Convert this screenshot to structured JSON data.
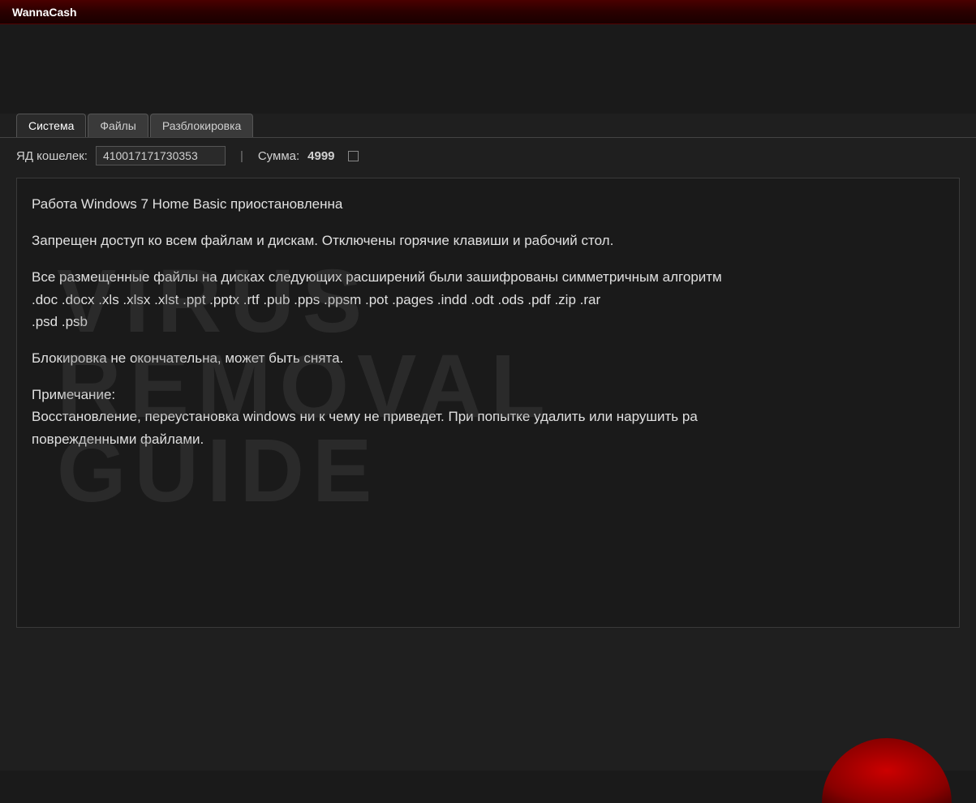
{
  "window": {
    "title": "WannaCash"
  },
  "tabs": [
    {
      "label": "Система",
      "active": true
    },
    {
      "label": "Файлы",
      "active": false
    },
    {
      "label": "Разблокировка",
      "active": false
    }
  ],
  "wallet": {
    "label": "ЯД кошелек:",
    "value": "410017171730353"
  },
  "amount": {
    "label": "Сумма:",
    "value": "4999"
  },
  "message": {
    "heading": "Работа Windows 7 Home Basic приостановленна",
    "p1": "Запрещен доступ ко всем файлам и дискам. Отключены горячие клавиши и рабочий стол.",
    "p2": "Все размещенные файлы на дисках следующих расширений были зашифрованы симметричным алгоритм",
    "p3": ".doc .docx .xls .xlsx .xlst .ppt .pptx .rtf .pub .pps .ppsm .pot .pages .indd .odt .ods .pdf .zip .rar",
    "p4": ".psd  .psb",
    "p5": "Блокировка не окончательна,  может быть снята.",
    "p6": "Примечание:",
    "p7": "Восстановление, переустановка windows ни к чему не приведет. При попытке удалить или нарушить ра",
    "p8": "поврежденными файлами."
  },
  "watermark": {
    "line1": "VIRUS",
    "line2": "REMOVAL",
    "line3": "GUIDE"
  }
}
